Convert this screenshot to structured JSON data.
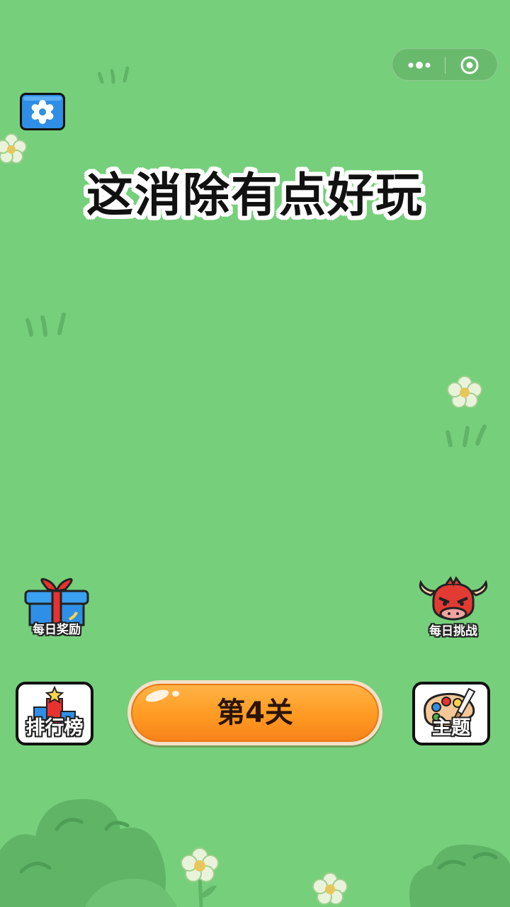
{
  "title": "这消除有点好玩",
  "buttons": {
    "daily_reward": "每日奖励",
    "daily_challenge": "每日挑战",
    "leaderboard": "排行榜",
    "theme": "主题",
    "level": "第4关"
  },
  "icons": {
    "settings": "gear-icon",
    "capsule_more": "more-dots-icon",
    "capsule_close": "close-target-icon"
  },
  "colors": {
    "background": "#76cf7b",
    "level_button": "#ff9a22",
    "settings_button": "#2f8fe6"
  }
}
